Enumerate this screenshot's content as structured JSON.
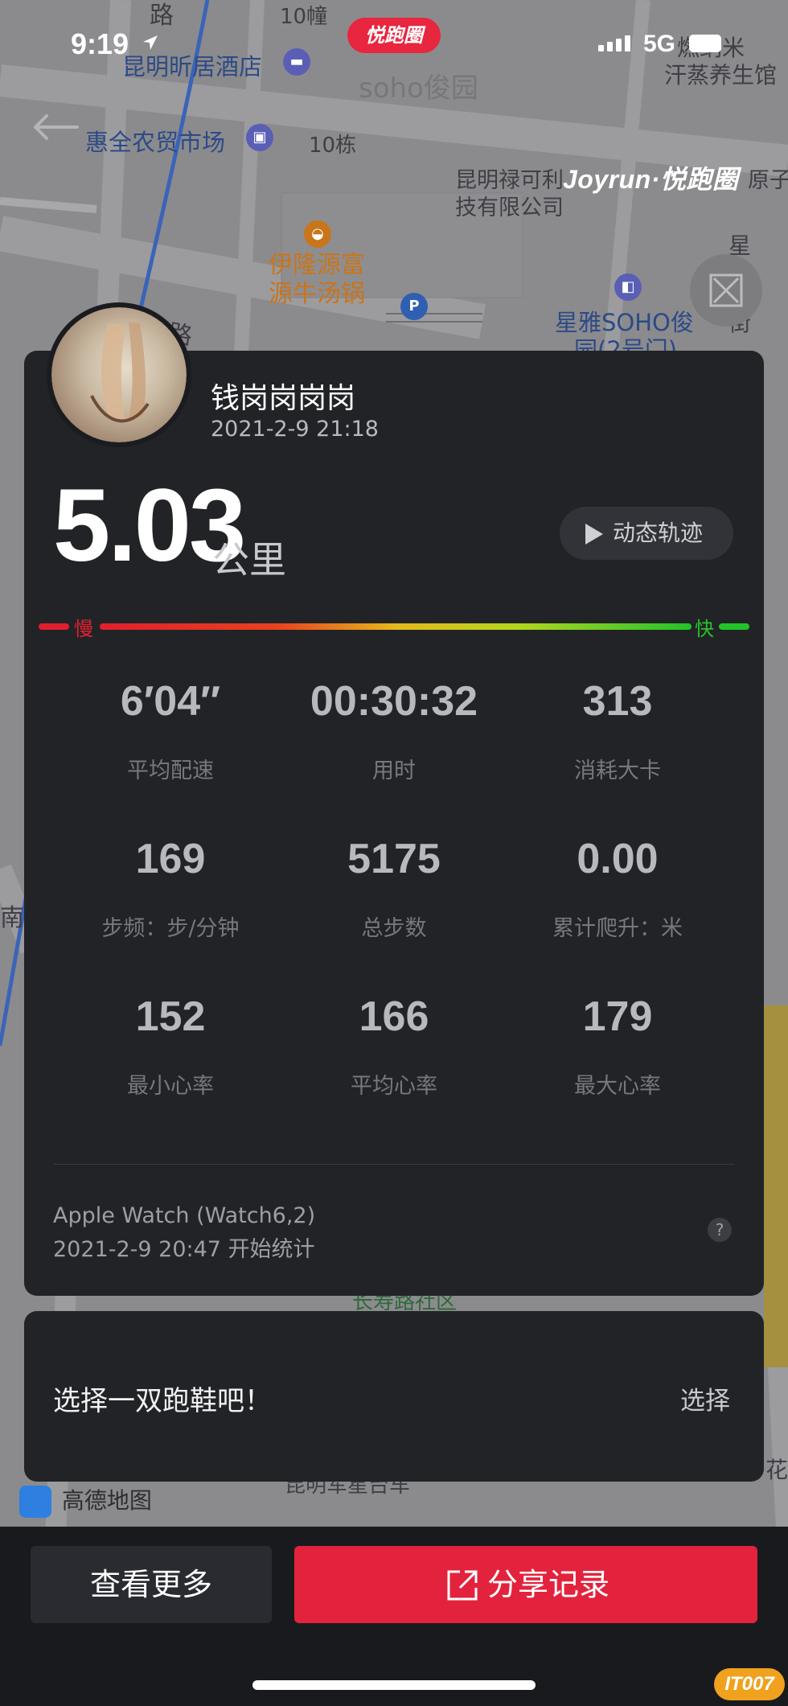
{
  "status_bar": {
    "time": "9:19",
    "app_pill": "悦跑圈",
    "network": "5G"
  },
  "map": {
    "labels": {
      "top_road": "路",
      "building_10_top": "10幢",
      "hotel": "昆明昕居酒店",
      "soho": "soho俊园",
      "top_right_1": "燃纳米",
      "top_right_2": "汗蒸养生馆",
      "market": "惠全农贸市场",
      "building_10": "10栋",
      "company_1": "昆明禄可利",
      "company_2": "技有限公司",
      "right_cut": "原子工",
      "restaurant_1": "伊隆源富",
      "restaurant_2": "源牛汤锅",
      "xingya_1": "星雅SOHO俊",
      "xingya_2": "园(2号门)",
      "street_vertical": "星雅岗街",
      "road_left": "联明路",
      "left_edge": "南",
      "community": "长寿路社区",
      "bottom_road": "昆明军星台车",
      "right_flower": "花"
    },
    "watermark": "Joyrun·悦跑圈",
    "amap_logo": "高德地图"
  },
  "profile": {
    "name": "钱岗岗岗岗",
    "datetime": "2021-2-9 21:18"
  },
  "summary": {
    "distance": "5.03",
    "unit": "公里",
    "replay_label": "动态轨迹",
    "slow_label": "慢",
    "fast_label": "快"
  },
  "stats": [
    {
      "value": "6′04″",
      "label": "平均配速"
    },
    {
      "value": "00:30:32",
      "label": "用时"
    },
    {
      "value": "313",
      "label": "消耗大卡"
    },
    {
      "value": "169",
      "label": "步频：步/分钟"
    },
    {
      "value": "5175",
      "label": "总步数"
    },
    {
      "value": "0.00",
      "label": "累计爬升：米"
    },
    {
      "value": "152",
      "label": "最小心率"
    },
    {
      "value": "166",
      "label": "平均心率"
    },
    {
      "value": "179",
      "label": "最大心率"
    }
  ],
  "device": {
    "name": "Apple Watch (Watch6,2)",
    "start": "2021-2-9 20:47 开始统计",
    "help": "?"
  },
  "shoes": {
    "prompt": "选择一双跑鞋吧！",
    "action": "选择"
  },
  "actions": {
    "more": "查看更多",
    "share": "分享记录"
  },
  "corner_logo": "IT007",
  "colors": {
    "accent_red": "#e3233d",
    "card_bg": "#222327",
    "slow": "#e62030",
    "fast": "#29c429"
  }
}
